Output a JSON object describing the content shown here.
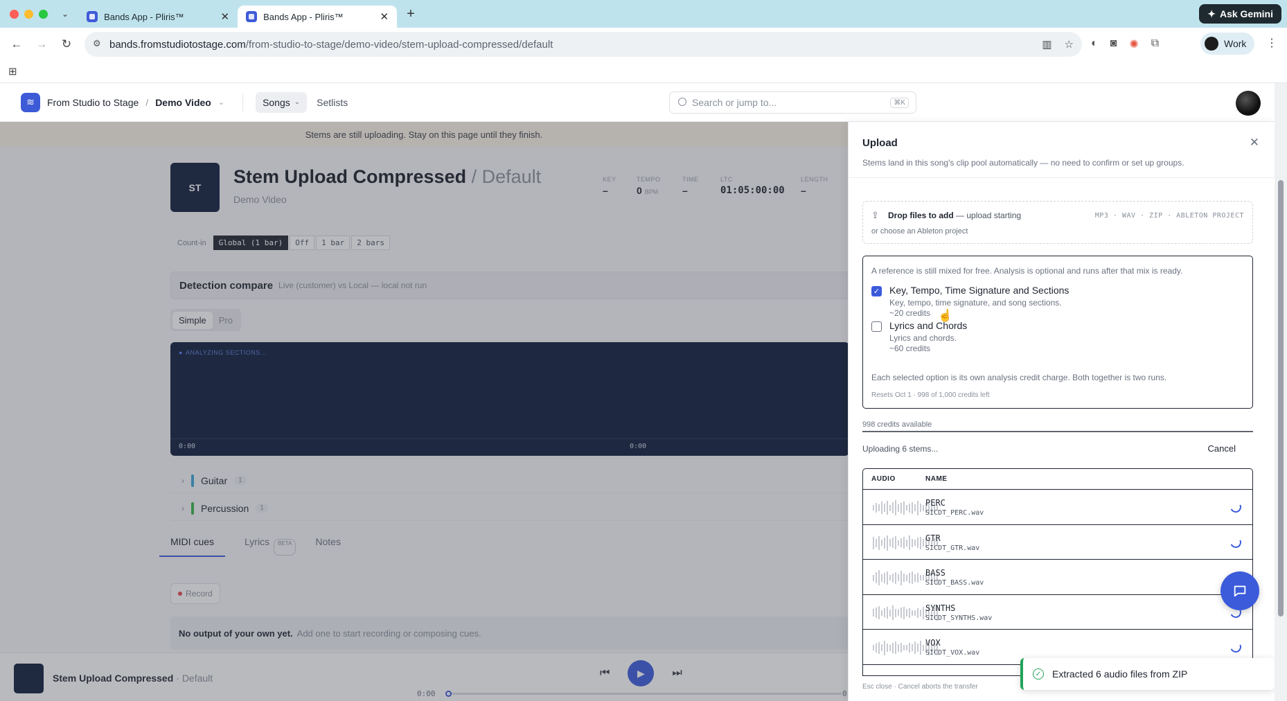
{
  "browser": {
    "tabs": [
      {
        "title": "Bands App - Pliris™",
        "active": false
      },
      {
        "title": "Bands App - Pliris™",
        "active": true
      }
    ],
    "ask_gemini": "Ask Gemini",
    "url_host": "bands.fromstudiotostage.com",
    "url_path": "/from-studio-to-stage/demo-video/stem-upload-compressed/default",
    "profile": "Work"
  },
  "header": {
    "org": "From Studio to Stage",
    "project": "Demo Video",
    "nav_songs": "Songs",
    "nav_setlists": "Setlists",
    "search_placeholder": "Search or jump to...",
    "search_kbd": "⌘K"
  },
  "banner": "Stems are still uploading. Stay on this page until they finish.",
  "song": {
    "initials": "ST",
    "title": "Stem Upload Compressed",
    "variant": "/ Default",
    "subtitle": "Demo Video",
    "meta": {
      "key_label": "KEY",
      "key_value": "–",
      "tempo_label": "TEMPO",
      "tempo_value": "0",
      "tempo_unit": "BPM",
      "time_label": "TIME",
      "time_value": "–",
      "ltc_label": "LTC",
      "ltc_value": "01:05:00:00",
      "length_label": "LENGTH",
      "length_value": "–"
    },
    "countin": {
      "label": "Count-in",
      "options": [
        "Global (1 bar)",
        "Off",
        "1 bar",
        "2 bars"
      ],
      "selected": "Global (1 bar)"
    }
  },
  "detection": {
    "title": "Detection compare",
    "subtitle": "Live (customer) vs Local — local not run",
    "modes": [
      "Simple",
      "Pro"
    ],
    "selected_mode": "Simple"
  },
  "waveform": {
    "status": "ANALYZING SECTIONS...",
    "time_start": "0:00",
    "time_mid": "0:00"
  },
  "tracks": [
    {
      "name": "Guitar",
      "count": "1",
      "color": "#3aa5d8"
    },
    {
      "name": "Percussion",
      "count": "1",
      "color": "#3bb54a"
    }
  ],
  "bottom_tabs": {
    "midi": "MIDI cues",
    "lyrics": "Lyrics",
    "lyrics_badge": "BETA",
    "notes": "Notes"
  },
  "record_label": "Record",
  "no_output": {
    "bold": "No output of your own yet.",
    "rest": "Add one to start recording or composing cues."
  },
  "player": {
    "title": "Stem Upload Compressed",
    "variant": "· Default",
    "time": "0:00",
    "time_end": "0",
    "progress": 0
  },
  "upload": {
    "title": "Upload",
    "description": "Stems land in this song's clip pool automatically — no need to confirm or set up groups.",
    "drop_bold": "Drop files to add",
    "drop_rest": " — upload starting",
    "drop_formats": "MP3 · WAV · ZIP · ABLETON PROJECT",
    "drop_alt": "or choose an Ableton project",
    "analysis_intro": "A reference is still mixed for free. Analysis is optional and runs after that mix is ready.",
    "options": [
      {
        "title": "Key, Tempo, Time Signature and Sections",
        "desc": "Key, tempo, time signature, and song sections.",
        "credits": "~20 credits",
        "checked": true
      },
      {
        "title": "Lyrics and Chords",
        "desc": "Lyrics and chords.",
        "credits": "~60 credits",
        "checked": false
      }
    ],
    "each_note": "Each selected option is its own analysis credit charge. Both together is two runs.",
    "resets": "Resets Oct 1 · 998 of 1,000 credits left",
    "available": "998 credits available",
    "uploading": "Uploading 6 stems...",
    "cancel": "Cancel",
    "col_audio": "AUDIO",
    "col_name": "NAME",
    "stems": [
      {
        "name": "PERC",
        "file": "SICDT_PERC.wav"
      },
      {
        "name": "GTR",
        "file": "SICDT_GTR.wav"
      },
      {
        "name": "BASS",
        "file": "SICDT_BASS.wav"
      },
      {
        "name": "SYNTHS",
        "file": "SICDT_SYNTHS.wav"
      },
      {
        "name": "VOX",
        "file": "SICDT_VOX.wav"
      }
    ],
    "footer": "Esc close · Cancel aborts the transfer"
  },
  "toast": "Extracted 6 audio files from ZIP",
  "colors": {
    "accent": "#3b5bdb",
    "navy": "#0f1d3a",
    "success": "#22a35a"
  }
}
